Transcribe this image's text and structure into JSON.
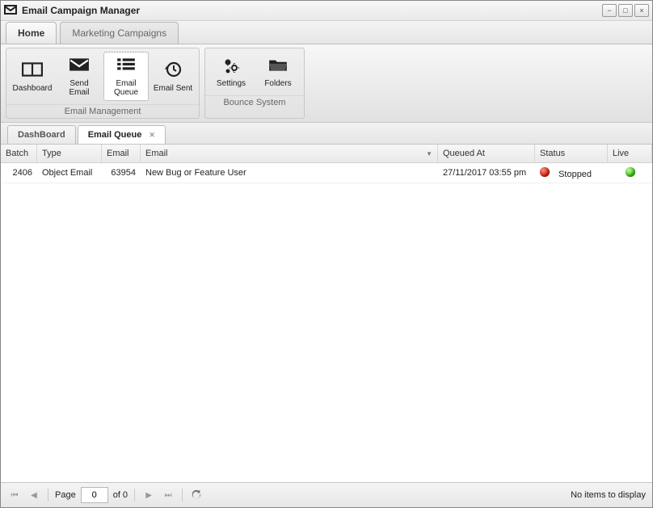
{
  "window": {
    "title": "Email Campaign Manager"
  },
  "main_tabs": {
    "active": "Home",
    "inactive": "Marketing Campaigns"
  },
  "ribbon": {
    "group1_label": "Email Management",
    "group2_label": "Bounce System",
    "dashboard": "Dashboard",
    "send_email": "Send Email",
    "email_queue": "Email Queue",
    "email_sent": "Email Sent",
    "settings": "Settings",
    "folders": "Folders"
  },
  "subtabs": {
    "dashboard": "DashBoard",
    "queue": "Email Queue"
  },
  "columns": {
    "batch": "Batch",
    "type": "Type",
    "email_id": "Email",
    "email": "Email",
    "queued_at": "Queued At",
    "status": "Status",
    "live": "Live"
  },
  "rows": [
    {
      "batch": "2406",
      "type": "Object Email",
      "email_id": "63954",
      "email": "New Bug or Feature User",
      "queued_at": "27/11/2017 03:55 pm",
      "status": "Stopped",
      "status_color": "red",
      "live_color": "green"
    }
  ],
  "pager": {
    "page_label": "Page",
    "page_value": "0",
    "of_label": "of 0",
    "summary": "No items to display"
  }
}
